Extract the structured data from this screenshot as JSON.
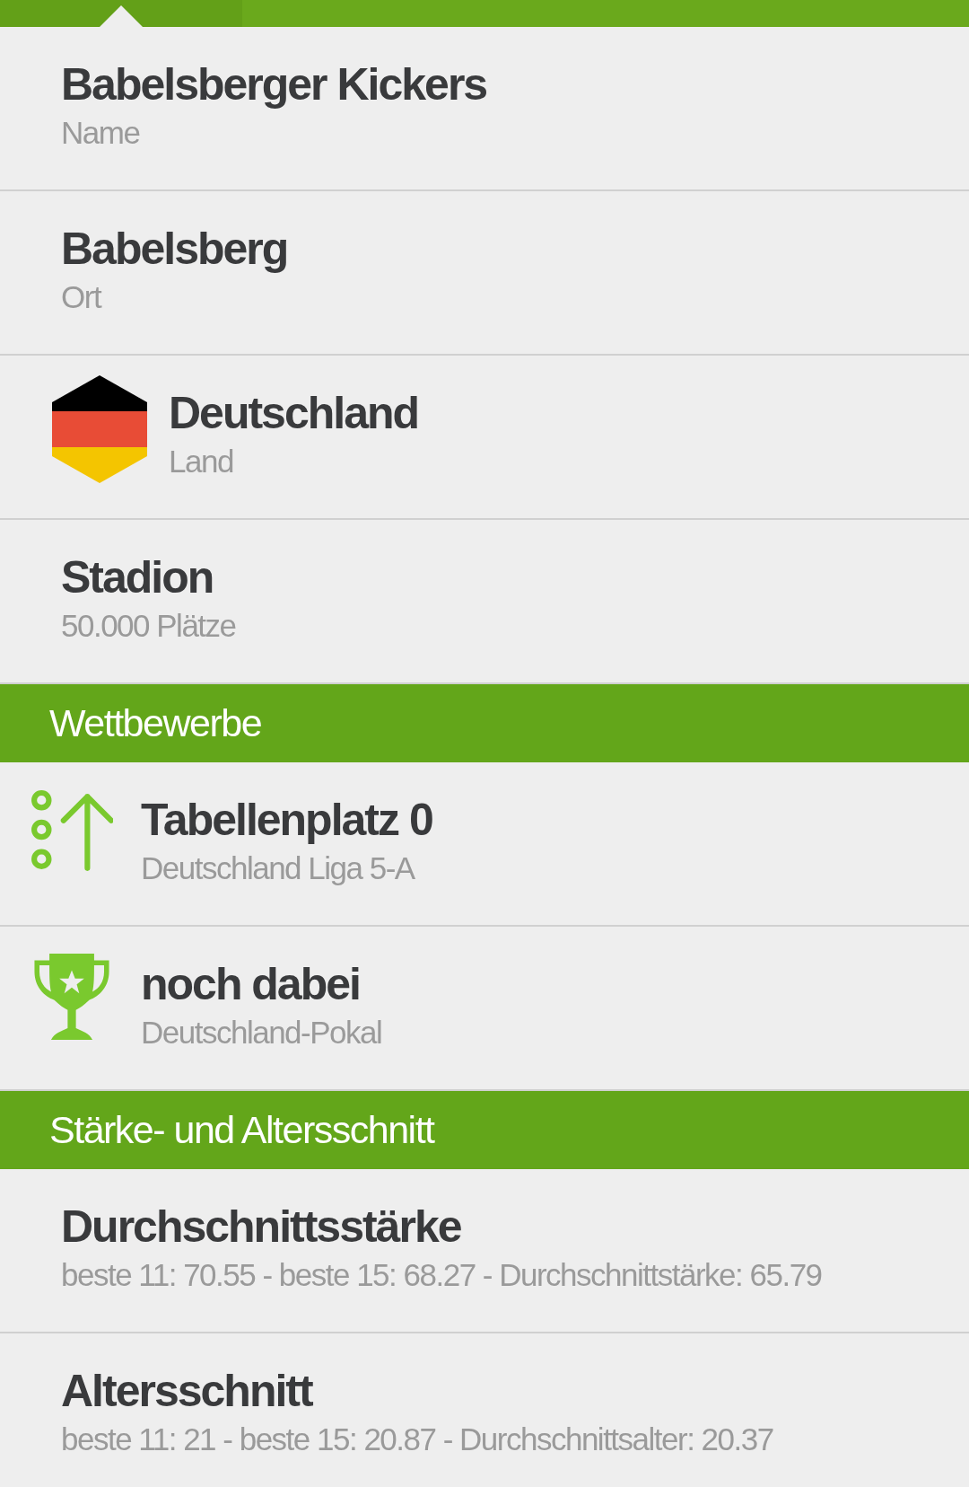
{
  "tab_bar": {
    "tabs": [
      {
        "selected": true
      },
      {
        "selected": false
      },
      {
        "selected": false
      },
      {
        "selected": false
      }
    ]
  },
  "sections": [
    {
      "items": [
        {
          "kind": "plain",
          "title": "Babelsberger Kickers",
          "subtitle": "Name"
        },
        {
          "kind": "plain",
          "title": "Babelsberg",
          "subtitle": "Ort"
        },
        {
          "kind": "flag",
          "title": "Deutschland",
          "subtitle": "Land"
        },
        {
          "kind": "plain",
          "title": "Stadion",
          "subtitle": "50.000 Plätze"
        }
      ]
    },
    {
      "header": "Wettbewerbe",
      "items": [
        {
          "kind": "rank",
          "title": "Tabellenplatz 0",
          "subtitle": "Deutschland Liga 5-A"
        },
        {
          "kind": "trophy",
          "title": "noch dabei",
          "subtitle": "Deutschland-Pokal"
        }
      ]
    },
    {
      "header": "Stärke- und Altersschnitt",
      "items": [
        {
          "kind": "plain",
          "title": "Durchschnittsstärke",
          "subtitle": "beste 11: 70.55 - beste 15: 68.27 - Durchschnittstärke: 65.79"
        },
        {
          "kind": "plain",
          "title": "Altersschnitt",
          "subtitle": "beste 11: 21 - beste 15: 20.87 - Durchschnittsalter: 20.37"
        }
      ]
    }
  ]
}
